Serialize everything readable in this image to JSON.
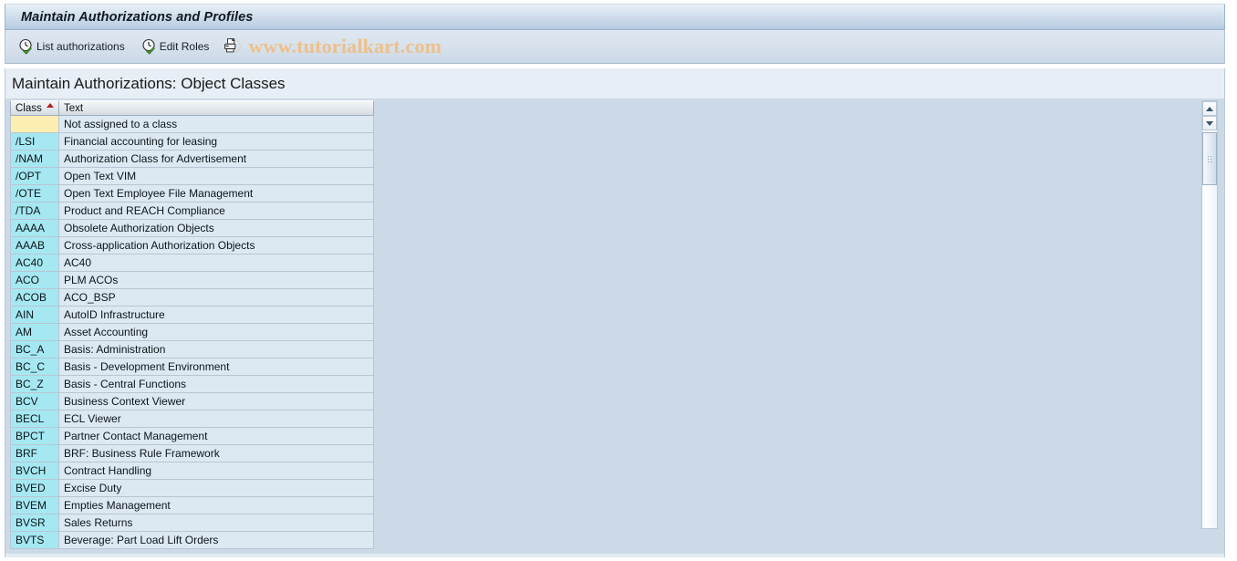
{
  "window": {
    "title": "Maintain Authorizations and Profiles"
  },
  "toolbar": {
    "buttons": [
      {
        "label": "List authorizations",
        "icon": "clock-check-icon"
      },
      {
        "label": "Edit Roles",
        "icon": "clock-check-icon"
      }
    ],
    "print_icon": "printer-icon",
    "watermark": "www.tutorialkart.com"
  },
  "screen": {
    "title": "Maintain Authorizations: Object Classes"
  },
  "grid": {
    "columns": [
      {
        "key": "class",
        "label": "Class",
        "sorted": "ascending"
      },
      {
        "key": "text",
        "label": "Text",
        "sorted": "none"
      }
    ],
    "rows": [
      {
        "class": "",
        "text": "Not assigned to a class"
      },
      {
        "class": "/LSI",
        "text": "Financial accounting for leasing"
      },
      {
        "class": "/NAM",
        "text": "Authorization Class for Advertisement"
      },
      {
        "class": "/OPT",
        "text": "Open Text VIM"
      },
      {
        "class": "/OTE",
        "text": "Open Text Employee File Management"
      },
      {
        "class": "/TDA",
        "text": "Product and REACH Compliance"
      },
      {
        "class": "AAAA",
        "text": "Obsolete Authorization Objects"
      },
      {
        "class": "AAAB",
        "text": "Cross-application Authorization Objects"
      },
      {
        "class": "AC40",
        "text": "AC40"
      },
      {
        "class": "ACO",
        "text": "PLM ACOs"
      },
      {
        "class": "ACOB",
        "text": "ACO_BSP"
      },
      {
        "class": "AIN",
        "text": "AutoID Infrastructure"
      },
      {
        "class": "AM",
        "text": "Asset Accounting"
      },
      {
        "class": "BC_A",
        "text": "Basis: Administration"
      },
      {
        "class": "BC_C",
        "text": "Basis - Development Environment"
      },
      {
        "class": "BC_Z",
        "text": "Basis - Central Functions"
      },
      {
        "class": "BCV",
        "text": "Business Context Viewer"
      },
      {
        "class": "BECL",
        "text": "ECL Viewer"
      },
      {
        "class": "BPCT",
        "text": "Partner Contact Management"
      },
      {
        "class": "BRF",
        "text": "BRF: Business Rule Framework"
      },
      {
        "class": "BVCH",
        "text": "Contract Handling"
      },
      {
        "class": "BVED",
        "text": "Excise Duty"
      },
      {
        "class": "BVEM",
        "text": "Empties Management"
      },
      {
        "class": "BVSR",
        "text": "Sales Returns"
      },
      {
        "class": "BVTS",
        "text": "Beverage: Part Load Lift Orders"
      }
    ]
  },
  "scrollbar": {
    "up_icon": "scroll-up-arrow-icon",
    "down_icon": "scroll-down-arrow-icon",
    "thumb": "scroll-thumb"
  },
  "colors": {
    "titlebar_accent": "#b9cde1",
    "class_cell": "#a5e8f2",
    "class_cell_empty": "#fdeeb2",
    "text_cell": "#dce9f3",
    "grid_background": "#ccdae7",
    "watermark": "#eec08a",
    "sort_arrow": "#b32020"
  }
}
